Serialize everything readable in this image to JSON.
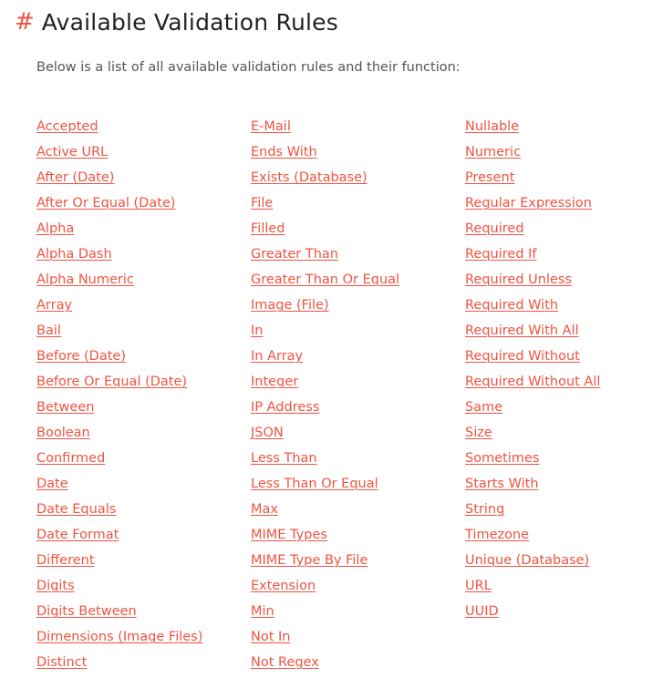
{
  "heading": {
    "hash": "#",
    "title": "Available Validation Rules"
  },
  "intro": "Below is a list of all available validation rules and their function:",
  "colors": {
    "accent": "#f05340",
    "title": "#222222",
    "body_text": "#555555"
  },
  "rules": {
    "column_1": [
      "Accepted",
      "Active URL",
      "After (Date)",
      "After Or Equal (Date)",
      "Alpha",
      "Alpha Dash",
      "Alpha Numeric",
      "Array",
      "Bail",
      "Before (Date)",
      "Before Or Equal (Date)",
      "Between",
      "Boolean",
      "Confirmed",
      "Date",
      "Date Equals",
      "Date Format",
      "Different",
      "Digits",
      "Digits Between",
      "Dimensions (Image Files)",
      "Distinct"
    ],
    "column_2": [
      "E-Mail",
      "Ends With",
      "Exists (Database)",
      "File",
      "Filled",
      "Greater Than",
      "Greater Than Or Equal",
      "Image (File)",
      "In",
      "In Array",
      "Integer",
      "IP Address",
      "JSON",
      "Less Than",
      "Less Than Or Equal",
      "Max",
      "MIME Types",
      "MIME Type By File",
      "Extension",
      "Min",
      "Not In",
      "Not Regex"
    ],
    "column_3": [
      "Nullable",
      "Numeric",
      "Present",
      "Regular Expression",
      "Required",
      "Required If",
      "Required Unless",
      "Required With",
      "Required With All",
      "Required Without",
      "Required Without All",
      "Same",
      "Size",
      "Sometimes",
      "Starts With",
      "String",
      "Timezone",
      "Unique (Database)",
      "URL",
      "UUID"
    ]
  }
}
